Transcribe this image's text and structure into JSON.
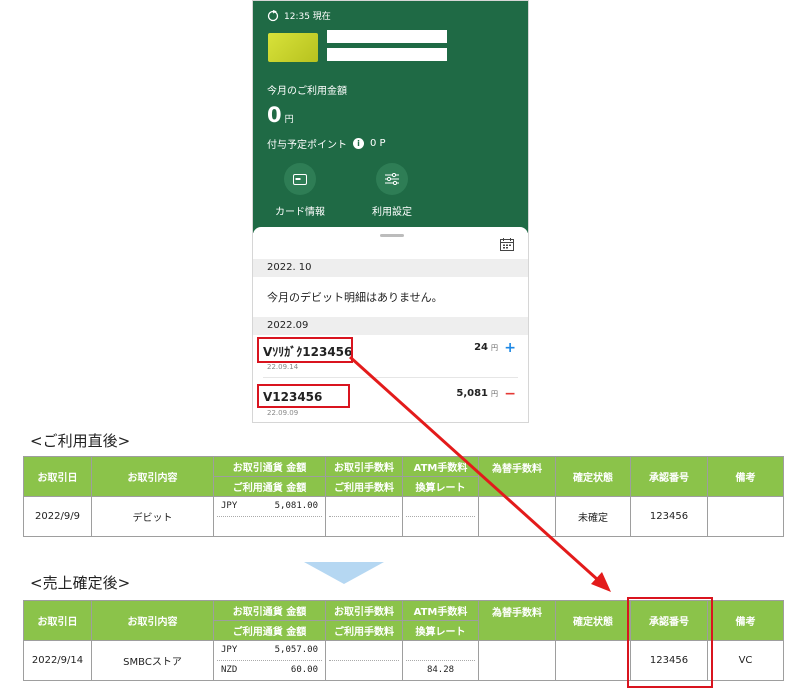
{
  "phone": {
    "time": "12:35 現在",
    "monthly_label": "今月のご利用金額",
    "monthly_amount": "0",
    "yen_unit": "円",
    "points_label": "付与予定ポイント",
    "points_value": "0 P",
    "actions": [
      {
        "label": "カード情報",
        "icon": "card-icon"
      },
      {
        "label": "利用設定",
        "icon": "settings-sliders-icon"
      }
    ],
    "section_oct": "2022. 10",
    "empty_message": "今月のデビット明細はありません。",
    "section_sep": "2022.09",
    "transactions": [
      {
        "name": "Vｿﾘｶﾞｸ123456",
        "date": "22.09.14",
        "amount": "24",
        "unit": "円",
        "sign": "+"
      },
      {
        "name": "V123456",
        "date": "22.09.09",
        "amount": "5,081",
        "unit": "円",
        "sign": "−"
      }
    ]
  },
  "section1_title": "<ご利用直後>",
  "section2_title": "<売上確定後>",
  "table_headers": {
    "date": "お取引日",
    "content": "お取引内容",
    "currency_amount": "お取引通貨 金額",
    "usage_amount": "ご利用通貨 金額",
    "fee": "お取引手数料",
    "usage_fee": "ご利用手数料",
    "atm_fee": "ATM手数料",
    "exchange_rate": "換算レート",
    "fx_fee": "為替手数料",
    "status": "確定状態",
    "approval": "承認番号",
    "note": "備考"
  },
  "table1_row": {
    "date": "2022/9/9",
    "content": "デビット",
    "cur1": "JPY",
    "amt1": "5,081.00",
    "status": "未確定",
    "approval": "123456",
    "note": ""
  },
  "table2_row": {
    "date": "2022/9/14",
    "content": "SMBCストア",
    "cur1": "JPY",
    "amt1": "5,057.00",
    "cur2": "NZD",
    "amt2": "60.00",
    "rate": "84.28",
    "status": "",
    "approval": "123456",
    "note": "VC"
  },
  "colors": {
    "brand_green": "#1f6a45",
    "header_green": "#8bc34a",
    "highlight_red": "#d9141f",
    "indicator_blue": "#b5d7f2"
  }
}
